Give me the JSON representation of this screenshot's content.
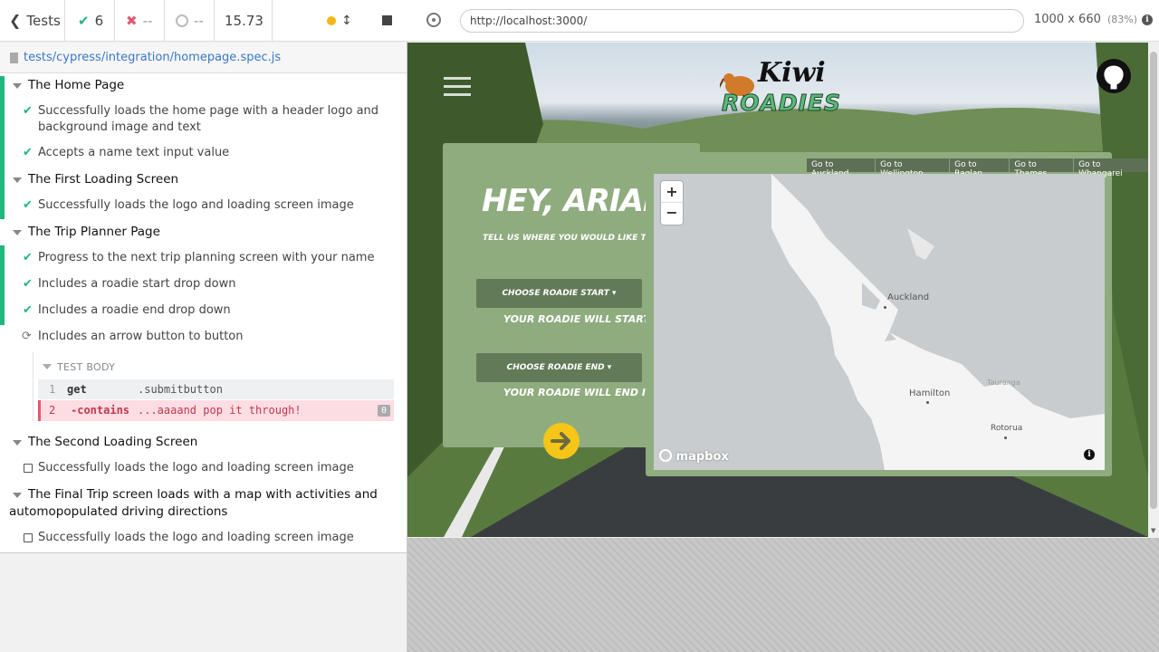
{
  "stats": {
    "back_label": "Tests",
    "passed": "6",
    "failed": "--",
    "pending": "--",
    "duration": "15.73"
  },
  "spec_path": "tests/cypress/integration/homepage.spec.js",
  "suites": {
    "home": {
      "title": "The Home Page",
      "t1": "Successfully loads the home page with a header logo and",
      "t1b": "background image and text",
      "t2": "Accepts a name text input value"
    },
    "first_loading": {
      "title": "The First Loading Screen",
      "t1": "Successfully loads the logo and loading screen image"
    },
    "trip_planner": {
      "title": "The Trip Planner Page",
      "t1": "Progress to the next trip planning screen with your name",
      "t2": "Includes a roadie start drop down",
      "t3": "Includes a roadie end drop down",
      "t4": "Includes an arrow button to button"
    },
    "test_body": {
      "label": "TEST BODY",
      "l1_num": "1",
      "l1_cmd": "get",
      "l1_arg": ".submitbutton",
      "l2_num": "2",
      "l2_cmd": "-contains",
      "l2_arg": "...aaaand pop it through!",
      "l2_badge": "0"
    },
    "second_loading": {
      "title": "The Second Loading Screen",
      "t1": "Successfully loads the logo and loading screen image"
    },
    "final_trip": {
      "title": "The Final Trip screen loads with a map with activities and",
      "title2": "automopopulated driving directions",
      "t1": "Successfully loads the logo and loading screen image"
    }
  },
  "browser": {
    "url": "http://localhost:3000/",
    "viewport": "1000 x 660",
    "zoom": "(83%)"
  },
  "app": {
    "logo_top": "Kiwi",
    "logo_bottom": "ROADIES",
    "greeting": "HEY, ARIANNA",
    "subtitle": "TELL US WHERE YOU WOULD LIKE TO GO!",
    "start_button": "CHOOSE ROADIE START",
    "start_caption": "YOUR ROADIE WILL START IN",
    "end_button": "CHOOSE ROADIE END",
    "end_caption": "YOUR ROADIE WILL END IN",
    "map_buttons": [
      "Go to Auckland",
      "Go to Wellington",
      "Go to Raglan",
      "Go to Thames",
      "Go to Whangarei"
    ],
    "zoom_in": "+",
    "zoom_out": "−",
    "cities": {
      "auckland": "Auckland",
      "hamilton": "Hamilton",
      "rotorua": "Rotorua",
      "tauranga": "Tauranga"
    },
    "mapbox_label": "mapbox",
    "info_label": "i"
  },
  "colors": {
    "pass": "#1fb77d",
    "fail": "#e45770",
    "panel": "#8fac7f",
    "panel_button": "#637a59",
    "arrow": "#f5c518"
  }
}
